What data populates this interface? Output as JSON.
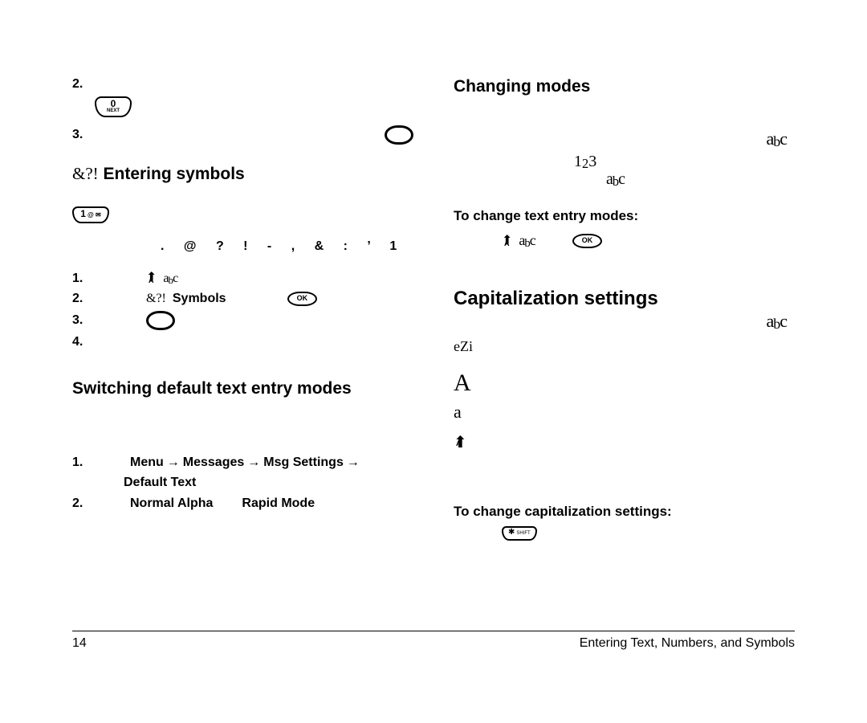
{
  "left": {
    "item2_num": "2.",
    "item3_num": "3.",
    "key_0next_big": "0",
    "key_0next_small": "NEXT",
    "heading_symbols_prefix": "&?!",
    "heading_symbols": "Entering symbols",
    "key_1_big": "1",
    "key_1_small": "@ ✉",
    "symbol_row": ".  @  ?  !  -  ,  &  :  ’  1",
    "s_item1_num": "1.",
    "s_item2_num": "2.",
    "s_item2_prefix": "&?!",
    "s_item2_label": "Symbols",
    "s_item3_num": "3.",
    "s_item4_num": "4.",
    "heading_switch": "Switching default text entry modes",
    "d_item1_num": "1.",
    "d_item1_a": "Menu",
    "d_item1_b": "Messages",
    "d_item1_c": "Msg Settings",
    "d_item1_d": "Default Text",
    "d_item2_num": "2.",
    "d_item2_a": "Normal Alpha",
    "d_item2_b": "Rapid Mode",
    "ok_label": "OK"
  },
  "right": {
    "heading_modes": "Changing modes",
    "heading_change_modes": "To change text entry modes:",
    "heading_caps": "Capitalization settings",
    "ezi": "eZi",
    "bigA": "A",
    "smalla": "a",
    "heading_change_caps": "To change capitalization settings:",
    "star": "✱",
    "shift_small": "SHIFT",
    "ok_label": "OK"
  },
  "footer": {
    "page": "14",
    "section": "Entering Text, Numbers, and Symbols"
  }
}
